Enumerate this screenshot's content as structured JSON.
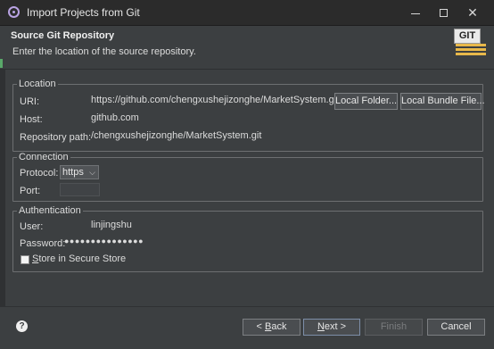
{
  "window": {
    "title": "Import Projects from Git",
    "minimize_icon": "minimize-icon",
    "maximize_icon": "maximize-icon",
    "close_glyph": "✕"
  },
  "header": {
    "title": "Source Git Repository",
    "description": "Enter the location of the source repository.",
    "badge_text": "GIT"
  },
  "location": {
    "legend": "Location",
    "uri_label": "URI:",
    "uri_value": "https://github.com/chengxushejizonghe/MarketSystem.git",
    "local_folder_button": "Local Folder...",
    "local_bundle_button": "Local Bundle File...",
    "host_label": "Host:",
    "host_value": "github.com",
    "repo_path_label": "Repository path:",
    "repo_path_value": "/chengxushejizonghe/MarketSystem.git"
  },
  "connection": {
    "legend": "Connection",
    "protocol_label": "Protocol:",
    "protocol_value": "https",
    "port_label": "Port:",
    "port_value": ""
  },
  "authentication": {
    "legend": "Authentication",
    "user_label": "User:",
    "user_value": "linjingshu",
    "password_label": "Password:",
    "password_mask": "●●●●●●●●●●●●●●●",
    "store_label_prefix": "",
    "store_label_underlined": "S",
    "store_label_rest": "tore in Secure Store",
    "store_checked": false
  },
  "footer": {
    "help_glyph": "?",
    "back_prefix": "< ",
    "back_underlined": "B",
    "back_rest": "ack",
    "next_underlined": "N",
    "next_rest": "ext >",
    "finish_label": "Finish",
    "cancel_label": "Cancel"
  },
  "colors": {
    "background": "#3c3f41",
    "titlebar": "#2b2b2b",
    "badge_accent": "#e8b84a"
  }
}
